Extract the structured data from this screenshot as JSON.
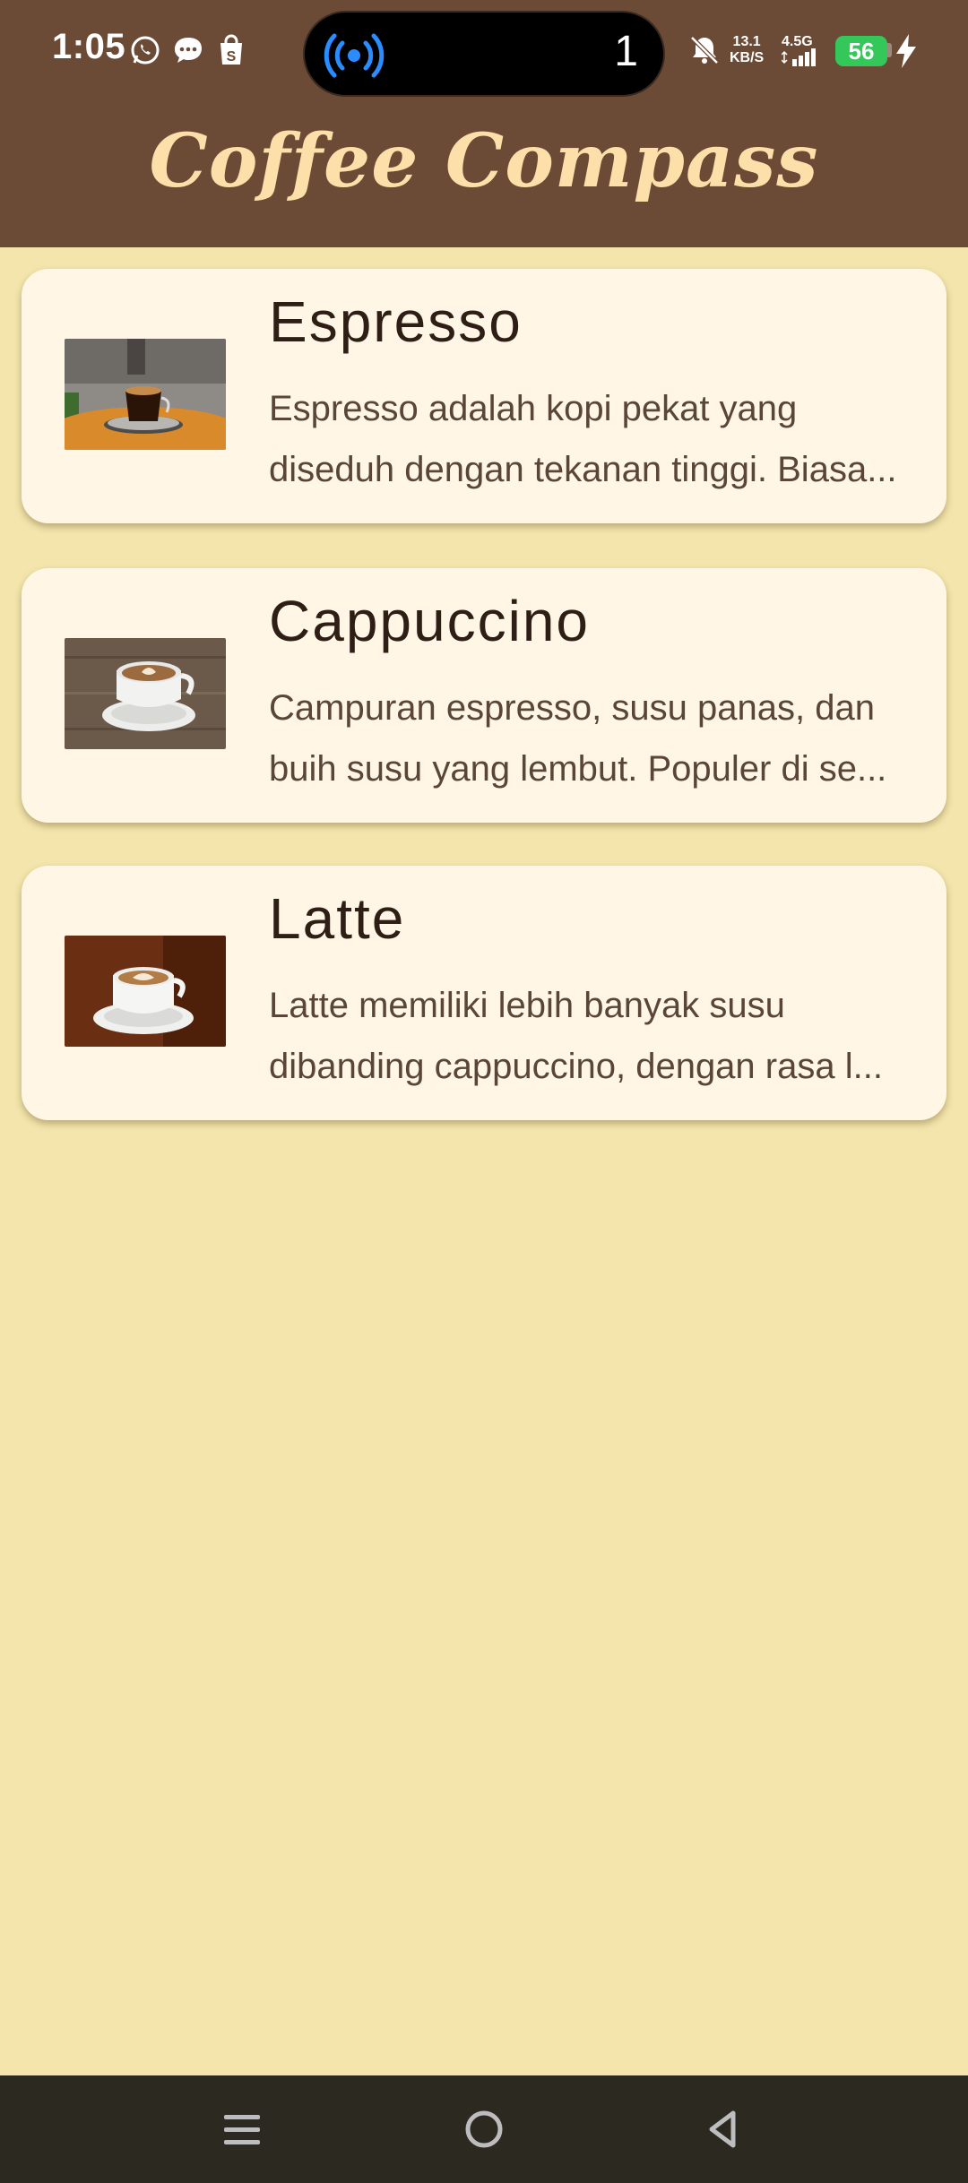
{
  "status_bar": {
    "time": "1:05",
    "notification_count": "1",
    "net_speed_value": "13.1",
    "net_speed_unit": "KB/S",
    "network_type": "4.5G",
    "battery_level": "56",
    "icons": [
      "whatsapp-icon",
      "chat-bubble-icon",
      "shopping-bag-icon",
      "broadcast-icon",
      "muted-bell-icon",
      "signal-icon",
      "battery-icon",
      "charging-bolt-icon"
    ]
  },
  "app": {
    "title": "Coffee Compass",
    "colors": {
      "app_bar": "#6B4A36",
      "title": "#FCDFA9",
      "background": "#F3E5AB",
      "card": "#FFF6E5",
      "nav_bar": "#2C2921"
    }
  },
  "coffees": [
    {
      "name": "Espresso",
      "description": "Espresso adalah kopi pekat yang diseduh dengan tekanan tinggi. Biasa..."
    },
    {
      "name": "Cappuccino",
      "description": "Campuran espresso, susu panas, dan buih susu yang lembut. Populer di se..."
    },
    {
      "name": "Latte",
      "description": "Latte memiliki lebih banyak susu dibanding cappuccino, dengan rasa l..."
    }
  ],
  "nav_bar": {
    "buttons": [
      "recents-menu-icon",
      "home-circle-icon",
      "back-triangle-icon"
    ]
  }
}
